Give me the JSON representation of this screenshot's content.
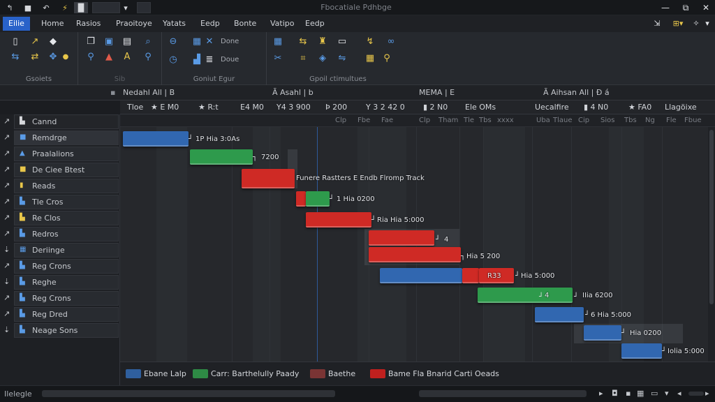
{
  "window": {
    "title": "Fbocatiale Pdhbge"
  },
  "quick_access": {
    "undo_icon": "↰",
    "redo_icon": "■",
    "save_icon": "↶",
    "pin_icon": "⚡",
    "doc_icon": "▐▌",
    "more_icon": "▾"
  },
  "window_controls": {
    "minimize": "—",
    "restore": "⧉",
    "close": "✕"
  },
  "tabs": [
    {
      "label": "Eilie"
    },
    {
      "label": "Home"
    },
    {
      "label": "Rasios"
    },
    {
      "label": "Praoitoye"
    },
    {
      "label": "Yatats"
    },
    {
      "label": "Eedp"
    },
    {
      "label": "Bonte"
    },
    {
      "label": "Vatipo"
    },
    {
      "label": "Eedp"
    }
  ],
  "tab_right_icons": {
    "a": "⇲",
    "b": "⊞▾",
    "c": "✧",
    "d": "▾"
  },
  "ribbon": {
    "groups": [
      {
        "label": "Gsoiets"
      },
      {
        "label": "Sib"
      },
      {
        "label": "Goniut Egur"
      },
      {
        "label": "Gpoil ctimultues"
      }
    ],
    "inputs": {
      "done": "Done",
      "doue": "Doue"
    }
  },
  "columns_top": [
    {
      "label": "Nedahl All | B"
    },
    {
      "label": "Ã Asahl | b"
    },
    {
      "label": "MEMA | E"
    },
    {
      "label": "Ã Aihsan All | Ð á"
    }
  ],
  "columns_mid": [
    {
      "label": "Tloe"
    },
    {
      "label": "★ E M0"
    },
    {
      "label": "★ R:t"
    },
    {
      "label": "E4 M0"
    },
    {
      "label": "Y4 3 900"
    },
    {
      "label": "Þ 200"
    },
    {
      "label": "Y 3 2 42 0"
    },
    {
      "label": "▮ 2 N0"
    },
    {
      "label": "Ele OMs"
    },
    {
      "label": "Uecalfire"
    },
    {
      "label": "▮ 4 N0"
    },
    {
      "label": "★ FA0"
    },
    {
      "label": "Llagöixe"
    }
  ],
  "columns_sub": [
    "Clp",
    "Fbe",
    "Fae",
    "Clp",
    "Tham",
    "Tle",
    "Tbs",
    "xxxx",
    "Uba",
    "Tlaue",
    "Cip",
    "Sios",
    "Tbs",
    "Ng",
    "Fle",
    "Fbue"
  ],
  "tasks": [
    {
      "label": "Cannd",
      "icon_color": "#d6d8dc"
    },
    {
      "label": "Remdrge",
      "icon_color": "#5a9be6"
    },
    {
      "label": "Praalalions",
      "icon_color": "#5a9be6"
    },
    {
      "label": "De Ciee Btest",
      "icon_color": "#e8c64a"
    },
    {
      "label": "Reads",
      "icon_color": "#e8c64a"
    },
    {
      "label": "Tle Cros",
      "icon_color": "#5a9be6"
    },
    {
      "label": "Re Clos",
      "icon_color": "#e8c64a"
    },
    {
      "label": "Redros",
      "icon_color": "#5a9be6"
    },
    {
      "label": "Deriinge",
      "icon_color": "#5a9be6"
    },
    {
      "label": "Reg Crons",
      "icon_color": "#5a9be6"
    },
    {
      "label": "Reghe",
      "icon_color": "#5a9be6"
    },
    {
      "label": "Reg Crons",
      "icon_color": "#5a9be6"
    },
    {
      "label": "Reg Dred",
      "icon_color": "#5a9be6"
    },
    {
      "label": "Neage Sons",
      "icon_color": "#5a9be6"
    }
  ],
  "bar_labels": {
    "b1": "1P Hia 3:0As",
    "b2": "7200",
    "b3": "Funere Rastters E Endb Flromp Track",
    "b4": "1 Hia 0200",
    "b5": "Ria Hia 5:000",
    "b6": "4",
    "b7": "Hia 5 200",
    "b8": "R33",
    "b9": "Hia 5:000",
    "b10": "IIia 6200",
    "b11": "6 Hia 5:000",
    "b12": "Hia 0200",
    "b13": "Iolia 5:000"
  },
  "legend": [
    {
      "label": "Ebane Lalp",
      "color": "#2f5f9e"
    },
    {
      "label": "Carr: Barthelully Paady",
      "color": "#2e8a45"
    },
    {
      "label": "Baethe",
      "color": "#7a3434"
    },
    {
      "label": "Bame Fla Bnarid Carti Oeads",
      "color": "#c0201e"
    }
  ],
  "status": {
    "text": "Ilelegle"
  },
  "colors": {
    "blue": "#3167b0",
    "green": "#2e9a4c",
    "red": "#cf2a25",
    "accent": "#2962c9"
  }
}
